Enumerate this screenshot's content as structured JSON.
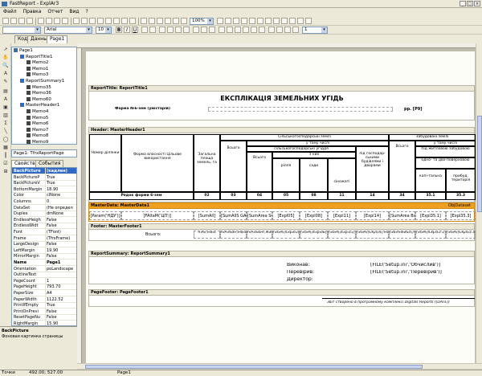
{
  "window": {
    "title": "FastReport - ExplAr3"
  },
  "menu": [
    "Файл",
    "Правка",
    "Отчет",
    "Вид",
    "?"
  ],
  "toolbar2": {
    "zoom": "100%",
    "page_input": "1"
  },
  "toolbar3": {
    "font_name": "Arial",
    "font_size": "10",
    "bold": "B",
    "italic": "I",
    "underline": "U",
    "line_width": "1"
  },
  "tabs": [
    "Код",
    "Данные",
    "Page1"
  ],
  "tree": [
    {
      "label": "Page1",
      "indent": 0,
      "color": "#3a6ea5"
    },
    {
      "label": "ReportTitle1",
      "indent": 1,
      "color": "#2a6bd1"
    },
    {
      "label": "Memo2",
      "indent": 2,
      "color": "#444"
    },
    {
      "label": "Memo1",
      "indent": 2,
      "color": "#444"
    },
    {
      "label": "Memo3",
      "indent": 2,
      "color": "#444"
    },
    {
      "label": "ReportSummary1",
      "indent": 1,
      "color": "#2a6bd1"
    },
    {
      "label": "Memo35",
      "indent": 2,
      "color": "#444"
    },
    {
      "label": "Memo36",
      "indent": 2,
      "color": "#444"
    },
    {
      "label": "Memo60",
      "indent": 2,
      "color": "#444"
    },
    {
      "label": "MasterHeader1",
      "indent": 1,
      "color": "#2a6bd1"
    },
    {
      "label": "Memo4",
      "indent": 2,
      "color": "#444"
    },
    {
      "label": "Memo5",
      "indent": 2,
      "color": "#444"
    },
    {
      "label": "Memo6",
      "indent": 2,
      "color": "#444"
    },
    {
      "label": "Memo7",
      "indent": 2,
      "color": "#444"
    },
    {
      "label": "Memo8",
      "indent": 2,
      "color": "#444"
    },
    {
      "label": "Memo9",
      "indent": 2,
      "color": "#444"
    }
  ],
  "object_combo": "Page1: TfrxReportPage",
  "prop_tabs": [
    "Свойства",
    "События"
  ],
  "properties": [
    {
      "name": "BackPicture",
      "value": "(кадлен)",
      "bold": true,
      "sel": true
    },
    {
      "name": "BackPictureP",
      "value": "True",
      "bold": false
    },
    {
      "name": "BackPictureV",
      "value": "True",
      "bold": false
    },
    {
      "name": "BottomMargin",
      "value": "18.90",
      "bold": false
    },
    {
      "name": "Color",
      "value": "clNone",
      "bold": false
    },
    {
      "name": "Columns",
      "value": "0",
      "bold": false
    },
    {
      "name": "DataSet",
      "value": "(Не определ",
      "bold": false
    },
    {
      "name": "Duplex",
      "value": "dmNone",
      "bold": false
    },
    {
      "name": "EndlessHeigh",
      "value": "False",
      "bold": false
    },
    {
      "name": "EndlessWidt",
      "value": "False",
      "bold": false
    },
    {
      "name": "Font",
      "value": "(TFont)",
      "bold": false
    },
    {
      "name": "Frame",
      "value": "(TfrxFrame)",
      "bold": false
    },
    {
      "name": "LargeDesign",
      "value": "False",
      "bold": false
    },
    {
      "name": "LeftMargin",
      "value": "19.90",
      "bold": false
    },
    {
      "name": "MirrorMargin",
      "value": "False",
      "bold": false
    },
    {
      "name": "Name",
      "value": "Page1",
      "bold": true
    },
    {
      "name": "Orientation",
      "value": "poLandscape",
      "bold": false
    },
    {
      "name": "OutlineText",
      "value": "",
      "bold": false
    },
    {
      "name": "PageCount",
      "value": "1",
      "bold": false
    },
    {
      "name": "PageHeight",
      "value": "793.70",
      "bold": false
    },
    {
      "name": "PaperSize",
      "value": "A4",
      "bold": false
    },
    {
      "name": "PaperWidth",
      "value": "1122.52",
      "bold": false
    },
    {
      "name": "PrintIfEmpty",
      "value": "True",
      "bold": false
    },
    {
      "name": "PrintOnPrevi",
      "value": "False",
      "bold": false
    },
    {
      "name": "ResetPageNu",
      "value": "False",
      "bold": false
    },
    {
      "name": "RightMargin",
      "value": "15.90",
      "bold": false
    }
  ],
  "desc": {
    "title": "BackPicture",
    "text": "Фоновая картинка страницы"
  },
  "bands": {
    "title_header": "ReportTitle: ReportTitle1",
    "header_header": "Header: MasterHeader1",
    "masterdata_header": "MasterData: MasterData1",
    "masterdata_ds": "ObjDataset",
    "footer_header": "Footer: MasterFooter1",
    "summary_header": "ReportSummary: ReportSummary1",
    "pagefooter_header": "PageFooter: PageFooter1"
  },
  "report": {
    "title": "ЕКСПЛІКАЦІЯ ЗЕМЕЛЬНИХ УГІДЬ",
    "form_label": "Форма №6-зем (умістарій)",
    "year": "рр. [P9]",
    "hdr_nom": "Номер ділянки",
    "hdr_form": "Форма власності Цільове використання",
    "hdr_total": "Загальна площа земель, га",
    "hdr_agri": "Сільськогосподарські землі",
    "hdr_vsogo": "Всього",
    "hdr_u_tomu": "у тому числі",
    "hdr_silgosp": "сільськогосподарські угіддя",
    "hdr_vsogo2": "Всього",
    "hdr_z_nyh": "з них",
    "hdr_rillia": "рілля",
    "hdr_sady": "сади",
    "hdr_sinozhati": "сіножаті",
    "hdr_pid_gosp": "під господар-ськими будівлями і дворами",
    "hdr_zabud": "Забудовані землі",
    "hdr_vsogo3": "Всього",
    "hdr_u_tomu2": "у тому числі",
    "hdr_pid_zhyt": "під житловою забудовою",
    "hdr_odno": "одно- та дво-поверховою",
    "hdr_kapit": "капі-тальна",
    "hdr_prybud": "прибуд. територія",
    "row_code_label": "Рядок форми 6-зем",
    "row_codes": [
      "02",
      "03",
      "04",
      "05",
      "08",
      "11",
      "14",
      "34",
      "35.1",
      "35.3"
    ],
    "master_cells": [
      "[Param('НДУ')]",
      "[FAltaM('ЦП')]",
      "[SumAll]",
      "[SumAllS GArea]",
      "[SumArea SG]",
      "[Expl05]",
      "[Expl08]",
      "[Expl11]",
      "[Expl14]",
      "[SumArea Bud]",
      "[Expl35.1]",
      "[Expl35.3]"
    ],
    "footer_label": "Всього:",
    "footer_cells": [
      "mAll,Mast",
      "mAllSGA,MasterDat",
      "mAllSGAr,MasterData",
      "[SUM([Expl05],Mas",
      "[SUM([Expl08],Mas",
      "[SUM([Expl11],Mas",
      "[SUM([Expl14],Mas",
      "[SumAllBud],MasterData",
      "[SUM([Expl35.1],Mas",
      "[SUM([Expl35.3],Mas"
    ],
    "sum_vykonav": "Виконав:",
    "sum_pereviryv": "Перевірив:",
    "sum_dyrektor": "Директор:",
    "sum_vykonav_val": "[FILE('Setup.ini','Обчислив')]",
    "sum_pereviryv_val": "[FILE('Setup.ini','Перевірив')]",
    "pagefooter_text": "Звіт створено в програмному комплексі Digitals Reports ([DATE])"
  },
  "status": {
    "units": "Точки",
    "coords": "492.00; 527.00",
    "page": "Page1"
  },
  "colors": {
    "masterdata_band": "#f0a020"
  }
}
